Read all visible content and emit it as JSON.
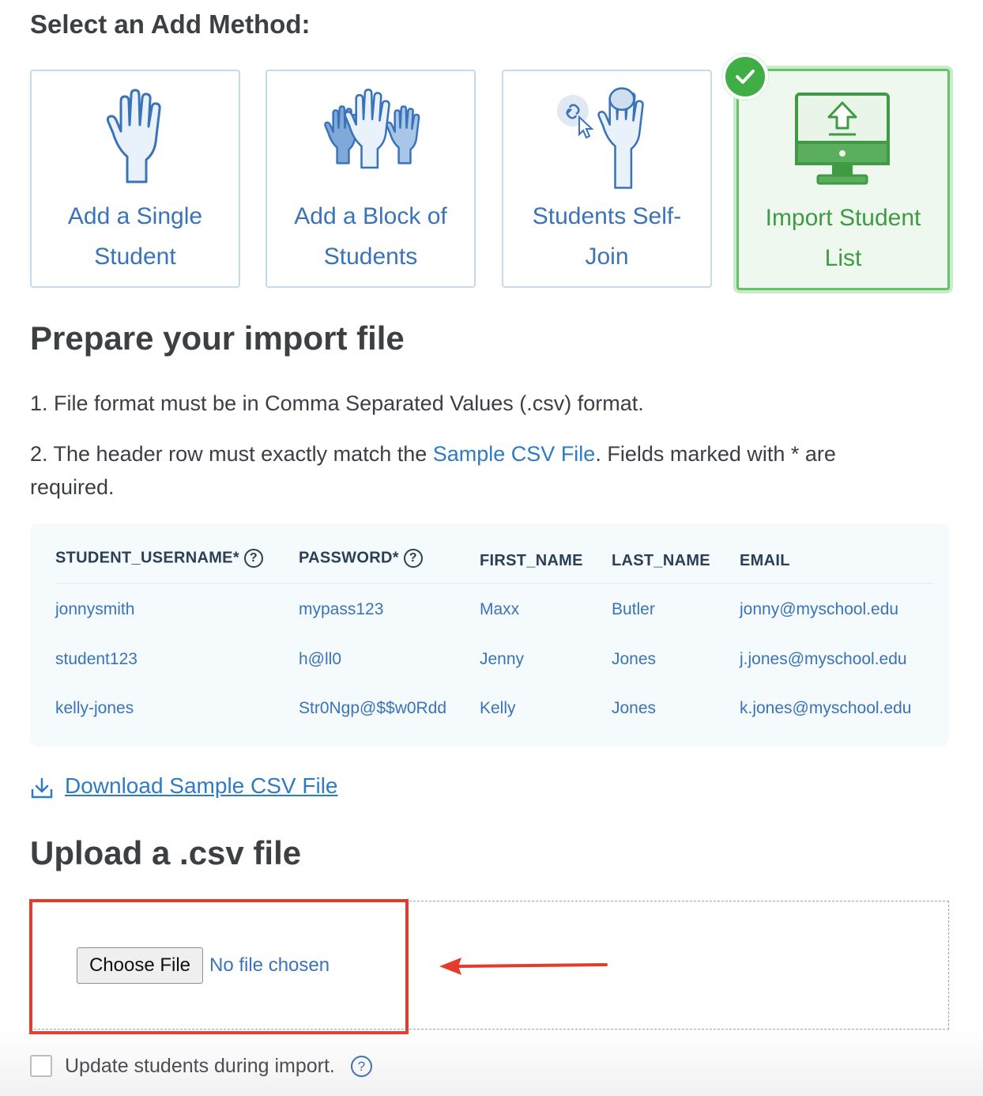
{
  "method_section": {
    "title": "Select an Add Method:",
    "cards": [
      {
        "label_line1": "Add a Single",
        "label_line2": "Student",
        "icon": "single-hand-icon"
      },
      {
        "label_line1": "Add a Block of",
        "label_line2": "Students",
        "icon": "multiple-hands-icon"
      },
      {
        "label_line1": "Students Self-",
        "label_line2": "Join",
        "icon": "self-join-icon"
      },
      {
        "label_line1": "Import Student",
        "label_line2": "List",
        "icon": "monitor-upload-icon",
        "selected": true
      }
    ],
    "selected_badge_icon": "checkmark-icon"
  },
  "prepare": {
    "heading": "Prepare your import file",
    "step1": "1. File format must be in Comma Separated Values (.csv) format.",
    "step2_prefix": "2. The header row must exactly match the ",
    "step2_link": "Sample CSV File",
    "step2_suffix_line1": ". Fields marked with * are",
    "step2_suffix_line2": "required."
  },
  "sample_table": {
    "headers": [
      "STUDENT_USERNAME*",
      "PASSWORD*",
      "FIRST_NAME",
      "LAST_NAME",
      "EMAIL"
    ],
    "rows": [
      [
        "jonnysmith",
        "mypass123",
        "Maxx",
        "Butler",
        "jonny@myschool.edu"
      ],
      [
        "student123",
        "h@ll0",
        "Jenny",
        "Jones",
        "j.jones@myschool.edu"
      ],
      [
        "kelly-jones",
        "Str0Ngp@$$w0Rdd",
        "Kelly",
        "Jones",
        "k.jones@myschool.edu"
      ]
    ],
    "help_glyph": "?"
  },
  "download": {
    "label": "Download Sample CSV File",
    "icon": "download-icon"
  },
  "upload": {
    "heading": "Upload a .csv file",
    "button_label": "Choose File",
    "status": "No file chosen"
  },
  "options": {
    "update_label": "Update students during import.",
    "update_checked": false,
    "help_glyph": "?"
  },
  "colors": {
    "accent_blue": "#3a73b8",
    "selected_green": "#3f9a43",
    "annotation_red": "#e63a2a"
  }
}
